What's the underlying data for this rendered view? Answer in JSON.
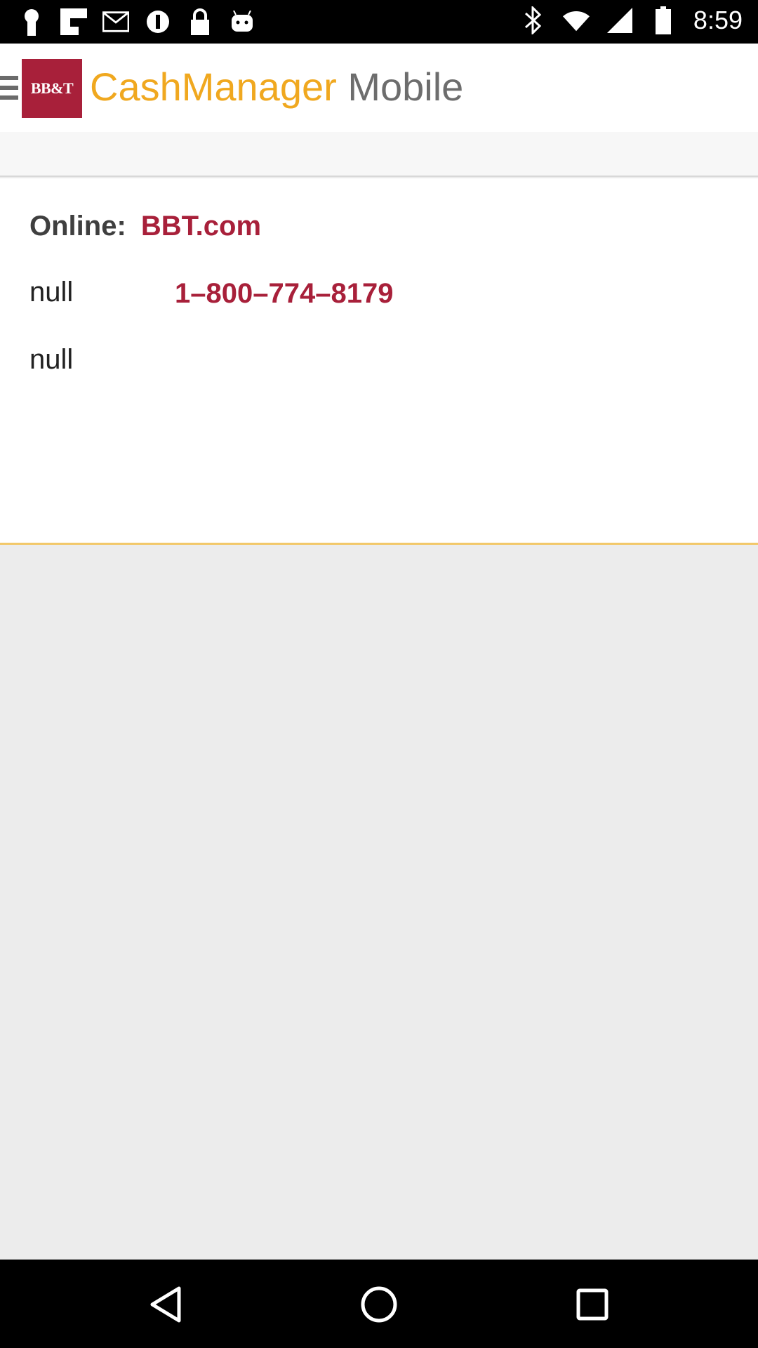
{
  "status_bar": {
    "time": "8:59",
    "left_icons": [
      "keyhole-icon",
      "flipboard-icon",
      "mail-icon",
      "shazam-icon",
      "lock-icon",
      "android-icon"
    ],
    "right_icons": [
      "bluetooth-icon",
      "wifi-icon",
      "signal-icon",
      "battery-icon"
    ]
  },
  "header": {
    "logo_text": "BB&T",
    "title_part1": "CashManager",
    "title_part2": "Mobile"
  },
  "contact": {
    "online_label": "Online:",
    "online_link": "BBT.com",
    "row2_label": "null",
    "phone": "1–800–774–8179",
    "row3_label": "null"
  },
  "colors": {
    "brand_red": "#a8203a",
    "brand_gold": "#f0a81f",
    "title_gray": "#6d6d6d"
  },
  "nav": {
    "icons": [
      "back-icon",
      "home-icon",
      "recents-icon"
    ]
  }
}
